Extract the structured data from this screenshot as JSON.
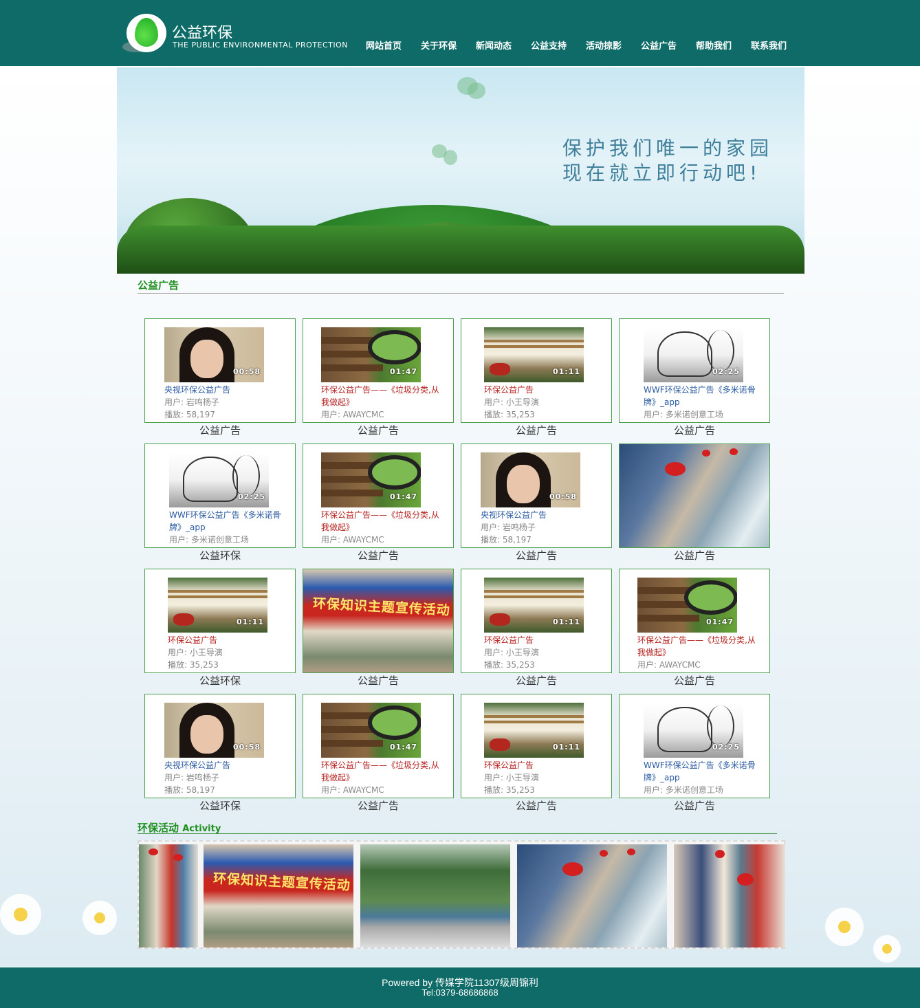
{
  "header": {
    "logo_title": "公益环保",
    "logo_subtitle": "THE PUBLIC ENVIRONMENTAL PROTECTION",
    "nav": [
      "网站首页",
      "关于环保",
      "新闻动态",
      "公益支持",
      "活动掠影",
      "公益广告",
      "帮助我们",
      "联系我们"
    ]
  },
  "banner": {
    "line1": "保护我们唯一的家园",
    "line2": "现在就立即行动吧!"
  },
  "ads_section": {
    "title": "公益广告"
  },
  "cards": [
    {
      "kind": "girl",
      "duration": "00:58",
      "title": "央视环保公益广告",
      "title_color": "blue",
      "lines": [
        "用户: 岩鸣杨子",
        "播放: 58,197"
      ],
      "caption": "公益广告"
    },
    {
      "kind": "bench",
      "duration": "01:47",
      "title": "环保公益广告——《垃圾分类,从我做起》",
      "title_color": "red",
      "lines": [
        "用户: AWAYCMC"
      ],
      "caption": "公益广告"
    },
    {
      "kind": "fence",
      "duration": "01:11",
      "title": "环保公益广告",
      "title_color": "red",
      "lines": [
        "用户: 小王导演",
        "播放: 35,253"
      ],
      "caption": "公益广告"
    },
    {
      "kind": "sketch",
      "duration": "02:25",
      "title": "WWF环保公益广告《多米诺骨牌》_app",
      "title_color": "blue",
      "lines": [
        "用户: 多米诺创意工场"
      ],
      "caption": "公益广告"
    },
    {
      "kind": "sketch",
      "duration": "02:25",
      "title": "WWF环保公益广告《多米诺骨牌》_app",
      "title_color": "blue",
      "lines": [
        "用户: 多米诺创意工场"
      ],
      "caption": "公益环保"
    },
    {
      "kind": "bench",
      "duration": "01:47",
      "title": "环保公益广告——《垃圾分类,从我做起》",
      "title_color": "red",
      "lines": [
        "用户: AWAYCMC"
      ],
      "caption": "公益广告"
    },
    {
      "kind": "girl",
      "duration": "00:58",
      "title": "央视环保公益广告",
      "title_color": "blue",
      "lines": [
        "用户: 岩鸣杨子",
        "播放: 58,197"
      ],
      "caption": "公益广告"
    },
    {
      "kind": "photo-clean",
      "caption": "公益广告"
    },
    {
      "kind": "fence",
      "duration": "01:11",
      "title": "环保公益广告",
      "title_color": "red",
      "lines": [
        "用户: 小王导演",
        "播放: 35,253"
      ],
      "caption": "公益环保"
    },
    {
      "kind": "photo-tent",
      "caption": "公益广告"
    },
    {
      "kind": "fence",
      "duration": "01:11",
      "title": "环保公益广告",
      "title_color": "red",
      "lines": [
        "用户: 小王导演",
        "播放: 35,253"
      ],
      "caption": "公益广告"
    },
    {
      "kind": "bench",
      "duration": "01:47",
      "title": "环保公益广告——《垃圾分类,从我做起》",
      "title_color": "red",
      "lines": [
        "用户: AWAYCMC"
      ],
      "caption": "公益广告"
    },
    {
      "kind": "girl",
      "duration": "00:58",
      "title": "央视环保公益广告",
      "title_color": "blue",
      "lines": [
        "用户: 岩鸣杨子",
        "播放: 58,197"
      ],
      "caption": "公益环保"
    },
    {
      "kind": "bench",
      "duration": "01:47",
      "title": "环保公益广告——《垃圾分类,从我做起》",
      "title_color": "red",
      "lines": [
        "用户: AWAYCMC"
      ],
      "caption": "公益广告"
    },
    {
      "kind": "fence",
      "duration": "01:11",
      "title": "环保公益广告",
      "title_color": "red",
      "lines": [
        "用户: 小王导演",
        "播放: 35,253"
      ],
      "caption": "公益广告"
    },
    {
      "kind": "sketch",
      "duration": "02:25",
      "title": "WWF环保公益广告《多米诺骨牌》_app",
      "title_color": "blue",
      "lines": [
        "用户: 多米诺创意工场"
      ],
      "caption": "公益广告"
    }
  ],
  "activity_section": {
    "title": "环保活动",
    "title_en": "Activity"
  },
  "activity_photos": [
    "photo-people2",
    "photo-tent",
    "photo-road",
    "photo-clean",
    "photo-people"
  ],
  "tent_banner_text": "环保知识主题宣传活动",
  "footer": {
    "line1": "Powered by 传媒学院11307级周锦利",
    "line2": "Tel:0379-68686868"
  },
  "colors": {
    "header_bg": "#0e6b68",
    "accent_green": "#1f8f1f",
    "card_border": "#4aa04a",
    "link_blue": "#2a5aa0",
    "link_red": "#b5201f"
  }
}
